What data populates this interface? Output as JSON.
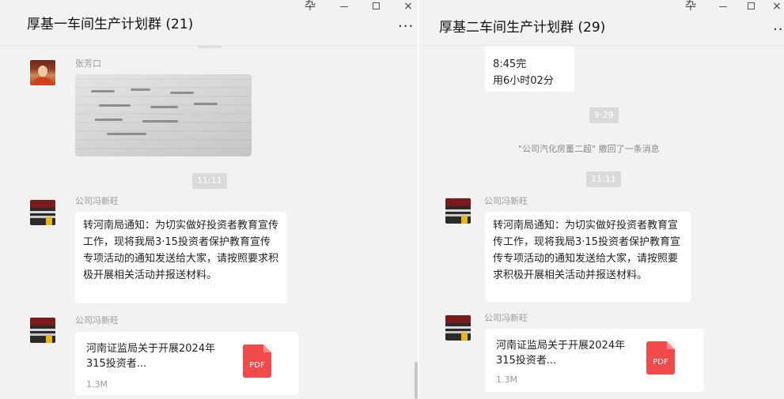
{
  "left": {
    "title": "厚基一车间生产计划群 (21)",
    "more": "...",
    "messages": {
      "m1": {
        "sender": "张芳口"
      },
      "ts1": "11:11",
      "m2": {
        "sender": "公司冯新旺",
        "text": "转河南局通知：为切实做好投资者教育宣传工作，现将我局3·15投资者保护教育宣传专项活动的通知发送给大家，请按照要求积极开展相关活动并报送材料。"
      },
      "m3": {
        "sender": "公司冯新旺",
        "file_name": "河南证监局关于开展2024年315投资者...",
        "file_size": "1.3M",
        "file_type": "PDF"
      }
    }
  },
  "right": {
    "title": "厚基二车间生产计划群 (29)",
    "more": "...",
    "messages": {
      "prev": {
        "line1": "8:45完",
        "line2": "用6小时02分"
      },
      "ts1": "9:29",
      "recall_notice": "\"公司汽化房董二超\" 撤回了一条消息",
      "ts2": "11:11",
      "m2": {
        "sender": "公司冯新旺",
        "text": "转河南局通知：为切实做好投资者教育宣传工作，现将我局3·15投资者保护教育宣传专项活动的通知发送给大家，请按照要求积极开展相关活动并报送材料。"
      },
      "m3": {
        "sender": "公司冯新旺",
        "file_name": "河南证监局关于开展2024年315投资者...",
        "file_size": "1.3M",
        "file_type": "PDF"
      }
    }
  },
  "window": {
    "pin": "卆",
    "min": "",
    "max": "",
    "close": "×"
  },
  "icons": {
    "pin": "pin-icon",
    "minimize": "minimize-icon",
    "maximize": "maximize-icon",
    "close": "close-icon",
    "more": "more-icon",
    "pdf": "pdf-file-icon"
  },
  "colors": {
    "pane_bg": "#f2f2f2",
    "bubble_bg": "#ffffff",
    "pdf_red": "#f04a4a",
    "timestamp_bg": "#dadada"
  }
}
